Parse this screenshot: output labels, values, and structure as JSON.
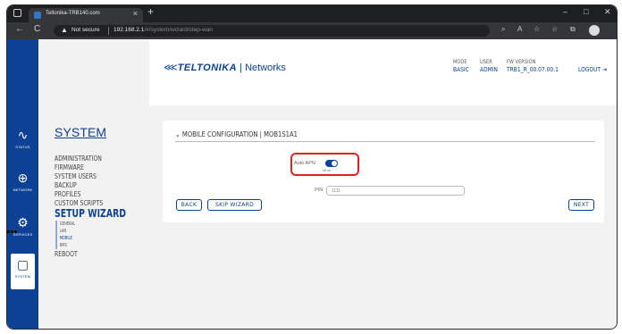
{
  "browser": {
    "tab_title": "Teltonika-TRB140.com",
    "tab_close": "×",
    "new_tab": "+",
    "window_controls": [
      "–",
      "□",
      "✕"
    ],
    "security_label": "Not secure",
    "url_host": "192.168.2.1",
    "url_path": "/#/system/wizard/step-wan",
    "nav": {
      "back": "←",
      "reload": "C"
    },
    "toolbar_icons": [
      "⌕",
      "A",
      "☆",
      "☆",
      "⧉"
    ]
  },
  "rail": {
    "items": [
      {
        "icon": "∿",
        "label": "STATUS"
      },
      {
        "icon": "⊕",
        "label": "NETWORK"
      },
      {
        "icon": "⚙",
        "label": "SERVICES"
      },
      {
        "icon": "▢",
        "label": "SYSTEM"
      }
    ]
  },
  "sidebar": {
    "title": "SYSTEM",
    "items": [
      "ADMINISTRATION",
      "FIRMWARE",
      "SYSTEM USERS",
      "BACKUP",
      "PROFILES",
      "CUSTOM SCRIPTS"
    ],
    "wizard": "SETUP WIZARD",
    "wizard_steps": [
      "GENERAL",
      "LAN",
      "MOBILE",
      "RMS"
    ],
    "reboot": "REBOOT"
  },
  "header": {
    "logo_brand": "TELTONIKA",
    "logo_sep": " | ",
    "logo_networks": "Networks",
    "mode_label": "MODE",
    "mode_value": "BASIC",
    "user_label": "USER",
    "user_value": "ADMIN",
    "fw_label": "FW VERSION",
    "fw_value": "TRB1_R_00.07.00.1",
    "logout": "LOGOUT"
  },
  "card": {
    "title": "MOBILE CONFIGURATION | MOB1S1A1",
    "auto_apn_label": "Auto APN",
    "auto_apn_state": "on",
    "toggle_sub": "off    on",
    "pin_label": "PIN",
    "pin_value": "1111",
    "back": "BACK",
    "skip": "SKIP WIZARD",
    "next": "NEXT"
  }
}
